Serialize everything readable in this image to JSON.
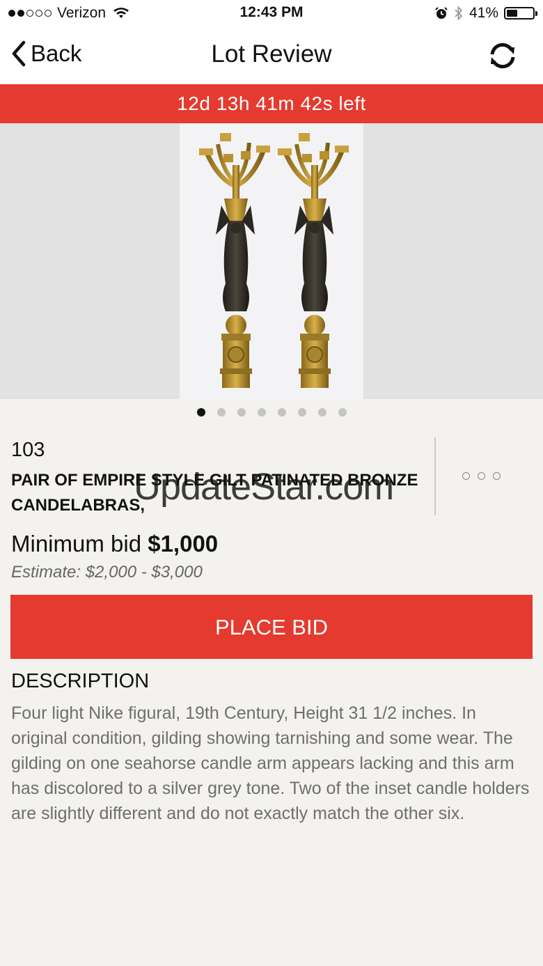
{
  "status_bar": {
    "carrier": "Verizon",
    "time": "12:43 PM",
    "battery_percent": "41%",
    "battery_level": 0.41,
    "signal_bars_filled": 2,
    "signal_bars_total": 5
  },
  "nav": {
    "back_label": "Back",
    "title": "Lot Review",
    "refresh_icon": "refresh-icon"
  },
  "countdown": "12d 13h 41m 42s left",
  "gallery": {
    "image_count": 8,
    "active_index": 0
  },
  "lot": {
    "number": "103",
    "title": "PAIR OF EMPIRE STYLE GILT PATINATED BRONZE CANDELABRAS,",
    "minimum_bid_label": "Minimum bid",
    "minimum_bid_value": "$1,000",
    "estimate": "Estimate: $2,000 - $3,000"
  },
  "watermark": "UpdateStar.com",
  "place_bid_label": "PLACE BID",
  "description": {
    "heading": "DESCRIPTION",
    "body": "Four light Nike figural, 19th Century, Height 31 1/2 inches.  In original condition, gilding showing tarnishing and some wear.  The gilding on one seahorse candle arm appears lacking and this arm has discolored to a silver grey tone.  Two of the inset candle holders are slightly different and do not exactly match the other six."
  },
  "colors": {
    "accent": "#e53a2f",
    "background": "#f3f2ef"
  }
}
